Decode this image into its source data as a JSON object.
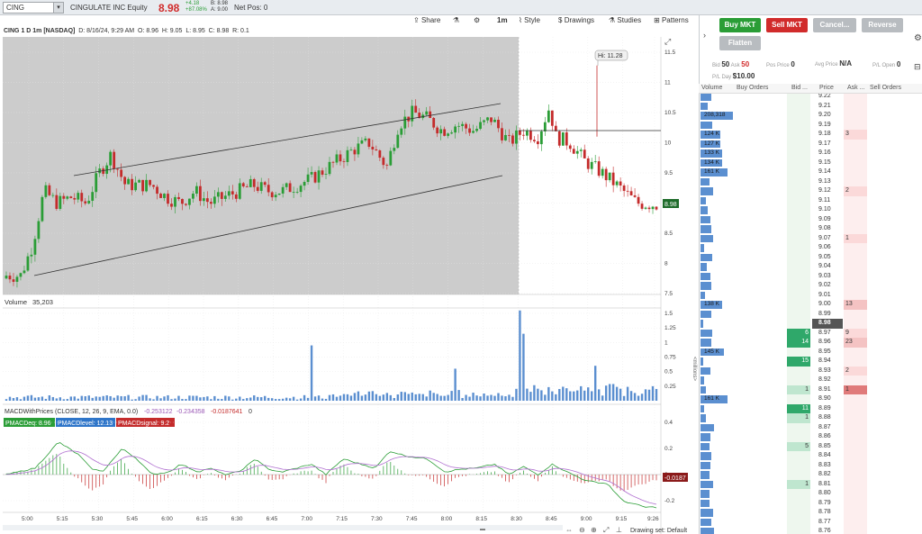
{
  "header": {
    "symbol": "CING",
    "instrument": "CINGULATE INC Equity",
    "last": "8.98",
    "change": "+4.18",
    "change_pct": "+87.08%",
    "bid": "B: 8.98",
    "ask": "A: 9.00",
    "net_pos": "Net Pos: 0"
  },
  "toolbar": {
    "share": "Share",
    "timeframe": "1m",
    "style": "Style",
    "drawings": "Drawings",
    "studies": "Studies",
    "patterns": "Patterns"
  },
  "chart_info": {
    "title": "CING 1 D 1m [NASDAQ]",
    "datetime": "D: 8/16/24, 9:29 AM",
    "open": "O: 8.96",
    "high": "H: 9.05",
    "low": "L: 8.95",
    "close": "C: 8.98",
    "range": "R: 0.1",
    "hi_label": "Hi: 11.28",
    "last_tag": "8.98"
  },
  "volume": {
    "label": "Volume",
    "value": "35,203",
    "unit_label": "<millions>"
  },
  "macd": {
    "study": "MACDWithPrices (CLOSE, 12, 26, 9, EMA, 0.0)",
    "v1": "-0.253122",
    "v2": "-0.234358",
    "v3": "-0.0187641",
    "v4": "0",
    "pmacdeq": "PMACDeq: 8.96",
    "pmacdlevel": "PMACDlevel: 12.13",
    "pmacdsignal": "PMACDsignal: 9.2",
    "last_tag": "-0.0187"
  },
  "footer": {
    "drawing_set": "Drawing set: Default"
  },
  "axes": {
    "price_ticks": [
      "11.5",
      "11",
      "10.5",
      "10",
      "9.5",
      "9",
      "8.5",
      "8",
      "7.5"
    ],
    "vol_ticks": [
      "1.5",
      "1.25",
      "1",
      "0.75",
      "0.5",
      "0.25"
    ],
    "macd_ticks": [
      "0.4",
      "0.2",
      "0",
      "-0.2"
    ],
    "time_ticks": [
      "5:00",
      "5:15",
      "5:30",
      "5:45",
      "6:00",
      "6:15",
      "6:30",
      "6:45",
      "7:00",
      "7:15",
      "7:30",
      "7:45",
      "8:00",
      "8:15",
      "8:30",
      "8:45",
      "9:00",
      "9:15",
      "9:26"
    ]
  },
  "order_panel": {
    "buy": "Buy MKT",
    "sell": "Sell MKT",
    "cancel": "Cancel...",
    "reverse": "Reverse",
    "flatten": "Flatten",
    "bid_size": "50",
    "ask_size": "50",
    "pos_label": "Pos Price",
    "pos_value": "0",
    "avg_label": "Avg Price",
    "avg_value": "N/A",
    "pl_label": "P/L Open",
    "pl_value": "0",
    "pl_day_label": "P/L Day",
    "pl_day_value": "$10.00"
  },
  "ladder": {
    "headers": [
      "Volume",
      "Buy Orders",
      "Bid ...",
      "Price",
      "Ask ...",
      "Sell Orders"
    ],
    "rows": [
      {
        "price": "9.22",
        "vol": "",
        "bid": "",
        "ask": ""
      },
      {
        "price": "9.21",
        "vol": "",
        "bid": "",
        "ask": ""
      },
      {
        "price": "9.20",
        "vol": "208,318",
        "bid": "",
        "ask": ""
      },
      {
        "price": "9.19",
        "vol": "",
        "bid": "",
        "ask": ""
      },
      {
        "price": "9.18",
        "vol": "124 K",
        "bid": "",
        "ask": "3"
      },
      {
        "price": "9.17",
        "vol": "127 K",
        "bid": "",
        "ask": ""
      },
      {
        "price": "9.16",
        "vol": "133 K",
        "bid": "",
        "ask": ""
      },
      {
        "price": "9.15",
        "vol": "134 K",
        "bid": "",
        "ask": ""
      },
      {
        "price": "9.14",
        "vol": "161 K",
        "bid": "",
        "ask": ""
      },
      {
        "price": "9.13",
        "vol": "",
        "bid": "",
        "ask": ""
      },
      {
        "price": "9.12",
        "vol": "",
        "bid": "",
        "ask": "2"
      },
      {
        "price": "9.11",
        "vol": "",
        "bid": "",
        "ask": ""
      },
      {
        "price": "9.10",
        "vol": "",
        "bid": "",
        "ask": ""
      },
      {
        "price": "9.09",
        "vol": "",
        "bid": "",
        "ask": ""
      },
      {
        "price": "9.08",
        "vol": "",
        "bid": "",
        "ask": ""
      },
      {
        "price": "9.07",
        "vol": "",
        "bid": "",
        "ask": "1"
      },
      {
        "price": "9.06",
        "vol": "",
        "bid": "",
        "ask": ""
      },
      {
        "price": "9.05",
        "vol": "",
        "bid": "",
        "ask": ""
      },
      {
        "price": "9.04",
        "vol": "",
        "bid": "",
        "ask": ""
      },
      {
        "price": "9.03",
        "vol": "",
        "bid": "",
        "ask": ""
      },
      {
        "price": "9.02",
        "vol": "",
        "bid": "",
        "ask": ""
      },
      {
        "price": "9.01",
        "vol": "",
        "bid": "",
        "ask": ""
      },
      {
        "price": "9.00",
        "vol": "138 K",
        "bid": "",
        "ask": "13"
      },
      {
        "price": "8.99",
        "vol": "",
        "bid": "",
        "ask": ""
      },
      {
        "price": "8.98",
        "vol": "",
        "bid": "",
        "ask": ""
      },
      {
        "price": "8.97",
        "vol": "",
        "bid": "6",
        "ask": "9"
      },
      {
        "price": "8.96",
        "vol": "",
        "bid": "14",
        "ask": "23"
      },
      {
        "price": "8.95",
        "vol": "145 K",
        "bid": "",
        "ask": ""
      },
      {
        "price": "8.94",
        "vol": "",
        "bid": "15",
        "ask": ""
      },
      {
        "price": "8.93",
        "vol": "",
        "bid": "",
        "ask": "2"
      },
      {
        "price": "8.92",
        "vol": "",
        "bid": "",
        "ask": ""
      },
      {
        "price": "8.91",
        "vol": "",
        "bid": "1",
        "ask": "1"
      },
      {
        "price": "8.90",
        "vol": "161 K",
        "bid": "",
        "ask": ""
      },
      {
        "price": "8.89",
        "vol": "",
        "bid": "11",
        "ask": ""
      },
      {
        "price": "8.88",
        "vol": "",
        "bid": "1",
        "ask": ""
      },
      {
        "price": "8.87",
        "vol": "",
        "bid": "",
        "ask": ""
      },
      {
        "price": "8.86",
        "vol": "",
        "bid": "",
        "ask": ""
      },
      {
        "price": "8.85",
        "vol": "",
        "bid": "5",
        "ask": ""
      },
      {
        "price": "8.84",
        "vol": "",
        "bid": "",
        "ask": ""
      },
      {
        "price": "8.83",
        "vol": "",
        "bid": "",
        "ask": ""
      },
      {
        "price": "8.82",
        "vol": "",
        "bid": "",
        "ask": ""
      },
      {
        "price": "8.81",
        "vol": "",
        "bid": "1",
        "ask": ""
      },
      {
        "price": "8.80",
        "vol": "",
        "bid": "",
        "ask": ""
      },
      {
        "price": "8.79",
        "vol": "",
        "bid": "",
        "ask": ""
      },
      {
        "price": "8.78",
        "vol": "",
        "bid": "",
        "ask": ""
      },
      {
        "price": "8.77",
        "vol": "",
        "bid": "",
        "ask": ""
      },
      {
        "price": "8.76",
        "vol": "",
        "bid": "",
        "ask": ""
      }
    ]
  },
  "colors": {
    "up": "#2a9d36",
    "down": "#c42b2b",
    "vol": "#5b8fd0",
    "premarket_bg": "#cccccc",
    "buy_btn": "#2a9d36",
    "sell_btn": "#d12b2b"
  }
}
